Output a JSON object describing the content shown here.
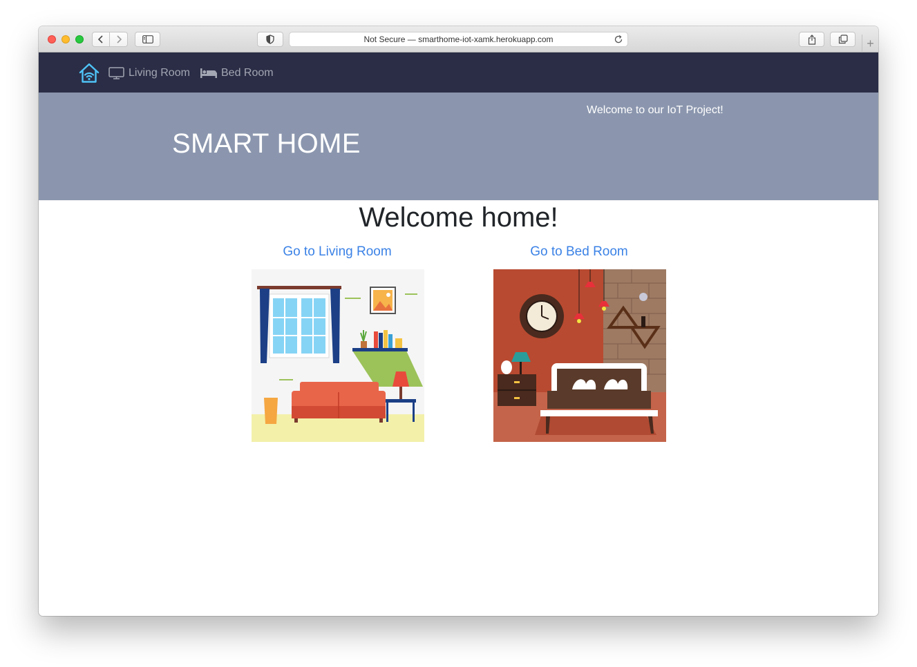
{
  "browser": {
    "url_text": "Not Secure — smarthome-iot-xamk.herokuapp.com"
  },
  "nav": {
    "links": [
      {
        "label": "Living Room",
        "icon": "monitor-icon"
      },
      {
        "label": "Bed Room",
        "icon": "bed-icon"
      }
    ],
    "brand_icon": "smart-home-wifi-icon"
  },
  "hero": {
    "title": "SMART HOME",
    "subtitle": "Welcome to our IoT Project!"
  },
  "main": {
    "heading": "Welcome home!",
    "rooms": [
      {
        "link_label": "Go to Living Room",
        "image": "living-room-illustration"
      },
      {
        "link_label": "Go to Bed Room",
        "image": "bed-room-illustration"
      }
    ]
  },
  "colors": {
    "navbar": "#2a2d45",
    "hero": "#8b96ae",
    "link": "#3b82e6",
    "brand_icon": "#4fc3f7"
  }
}
